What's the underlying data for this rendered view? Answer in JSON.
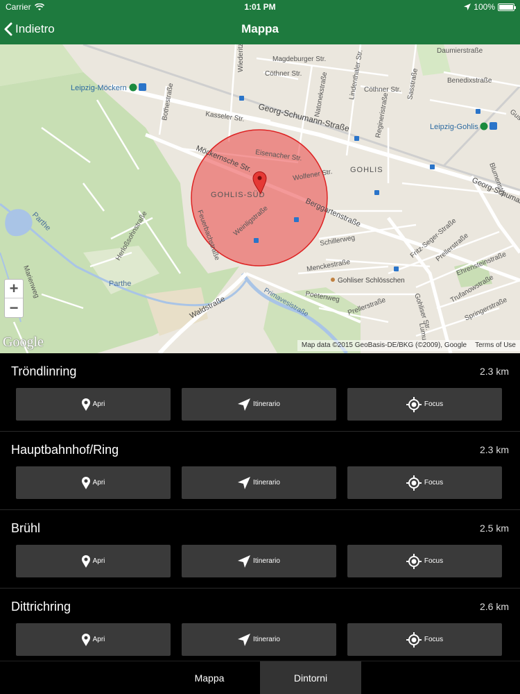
{
  "status": {
    "carrier": "Carrier",
    "time": "1:01 PM",
    "battery": "100%",
    "battery_level": 1.0
  },
  "nav": {
    "back_label": "Indietro",
    "title": "Mappa"
  },
  "map": {
    "labels": {
      "magdeburger": "Magdeburger Str.",
      "daumier": "Daumierstraße",
      "wiederitz": "Wiederitz",
      "cothner1": "Cöthner Str.",
      "lindenthaler": "Lindenthaler Str.",
      "cothner2": "Cöthner Str.",
      "benedix": "Benedixstraße",
      "leipzig_mockern": "Leipzig-Möckern",
      "natonek": "Natonekstraße",
      "sasstrasse": "Sasstraße",
      "gustav": "Gustav-",
      "georg1": "Georg-Schumann-Straße",
      "leipzig_gohlis": "Leipzig-Gohlis",
      "bothe": "Bothestraße",
      "kasseler": "Kasseler Str.",
      "regineri": "Regineristraße",
      "mockernsche": "Möckernsche Str.",
      "eisenacher": "Eisenacher Str.",
      "gohlis": "GOHLIS",
      "blumen": "Blumenstra",
      "wolfener": "Wolfener Str.",
      "georg2": "Georg-Schumann-",
      "gohlis_sud": "GOHLIS-SÜD",
      "berggarten": "Berggartenstraße",
      "parthe1": "Parthe",
      "weinlig": "Weinligstraße",
      "feuerbach": "Feuerbachstraße",
      "herlossohn": "Herloßsohnstraße",
      "schillerweg": "Schillerweg",
      "fritz": "Fritz-Seger-Straße",
      "prellerstrasse": "Prellerstraße",
      "ehrenstein": "Ehrensteinstraße",
      "menckestrasse": "Menckestraße",
      "schlosschen": "Gohliser Schlösschen",
      "parthe2": "Parthe",
      "marien": "Marienweg",
      "poetenweg": "Poetenweg",
      "prellerstrasse2": "Prellerstraße",
      "trufanow": "Trufanowstraße",
      "springer": "Springerstraße",
      "gohliser_str": "Gohliser Str.",
      "primavesi": "Primavesistraße",
      "waldstrasse": "Waldstraße",
      "lumu": "Lumu"
    },
    "zoom_in": "+",
    "zoom_out": "−",
    "logo": "Google",
    "attribution": "Map data ©2015 GeoBasis-DE/BKG (©2009), Google",
    "terms": "Terms of Use"
  },
  "places": [
    {
      "name": "Tröndlinring",
      "distance": "2.3 km",
      "open": "Apri",
      "route": "Itinerario",
      "focus": "Focus"
    },
    {
      "name": "Hauptbahnhof/Ring",
      "distance": "2.3 km",
      "open": "Apri",
      "route": "Itinerario",
      "focus": "Focus"
    },
    {
      "name": "Brühl",
      "distance": "2.5 km",
      "open": "Apri",
      "route": "Itinerario",
      "focus": "Focus"
    },
    {
      "name": "Dittrichring",
      "distance": "2.6 km",
      "open": "Apri",
      "route": "Itinerario",
      "focus": "Focus"
    }
  ],
  "tabs": [
    {
      "label": "Mappa"
    },
    {
      "label": "Dintorni"
    }
  ]
}
